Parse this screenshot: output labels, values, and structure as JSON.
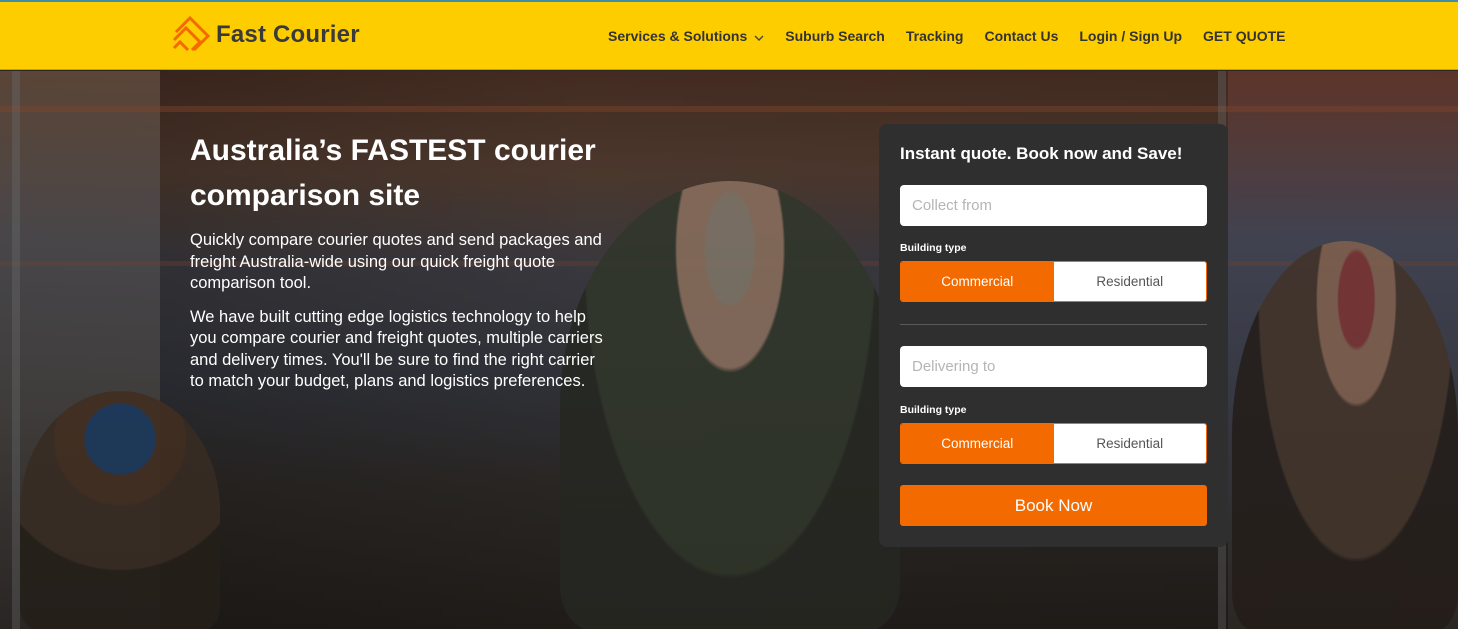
{
  "brand": {
    "name": "Fast Courier",
    "primary_color": "#fecd00",
    "accent_color": "#f26a00",
    "logo_icon": "stacked-stripes-logo"
  },
  "nav": {
    "items": [
      {
        "label": "Services & Solutions",
        "has_dropdown": true
      },
      {
        "label": "Suburb Search"
      },
      {
        "label": "Tracking"
      },
      {
        "label": "Contact Us"
      },
      {
        "label": "Login / Sign Up"
      },
      {
        "label": "GET QUOTE"
      }
    ]
  },
  "hero": {
    "headline": "Australia’s FASTEST courier comparison site",
    "paragraph1": "Quickly compare courier quotes and send packages and freight Australia-wide using our quick freight quote comparison tool.",
    "paragraph2": "We have built cutting edge logistics technology to help you compare courier and freight quotes, multiple carriers and delivery times. You'll be sure to find the right carrier to match your budget, plans and logistics preferences."
  },
  "quote_form": {
    "title": "Instant quote. Book now and Save!",
    "collect": {
      "placeholder": "Collect from",
      "value": ""
    },
    "collect_building": {
      "label": "Building type",
      "options": [
        "Commercial",
        "Residential"
      ],
      "selected": "Commercial"
    },
    "deliver": {
      "placeholder": "Delivering to",
      "value": ""
    },
    "deliver_building": {
      "label": "Building type",
      "options": [
        "Commercial",
        "Residential"
      ],
      "selected": "Commercial"
    },
    "submit_label": "Book Now"
  }
}
